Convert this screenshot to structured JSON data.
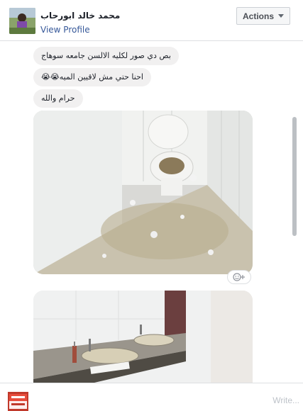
{
  "header": {
    "name": "محمد خالد ابورحاب",
    "view_profile": "View Profile",
    "actions_label": "Actions"
  },
  "messages": [
    {
      "text": "بص دي صور لكليه الالسن جامعه سوهاج"
    },
    {
      "text": "احنا حتي مش لاقيين الميه",
      "emoji": "😭😭"
    },
    {
      "text": "حرام والله"
    }
  ],
  "photos": [
    {
      "subject": "dirty restroom toilet"
    },
    {
      "subject": "dirty restroom sinks"
    }
  ],
  "composer": {
    "avatar_text": "اليوم السابع",
    "placeholder": "Write..."
  },
  "colors": {
    "link": "#365899",
    "bubble": "#f1f0f0",
    "border": "#dddfe2"
  }
}
